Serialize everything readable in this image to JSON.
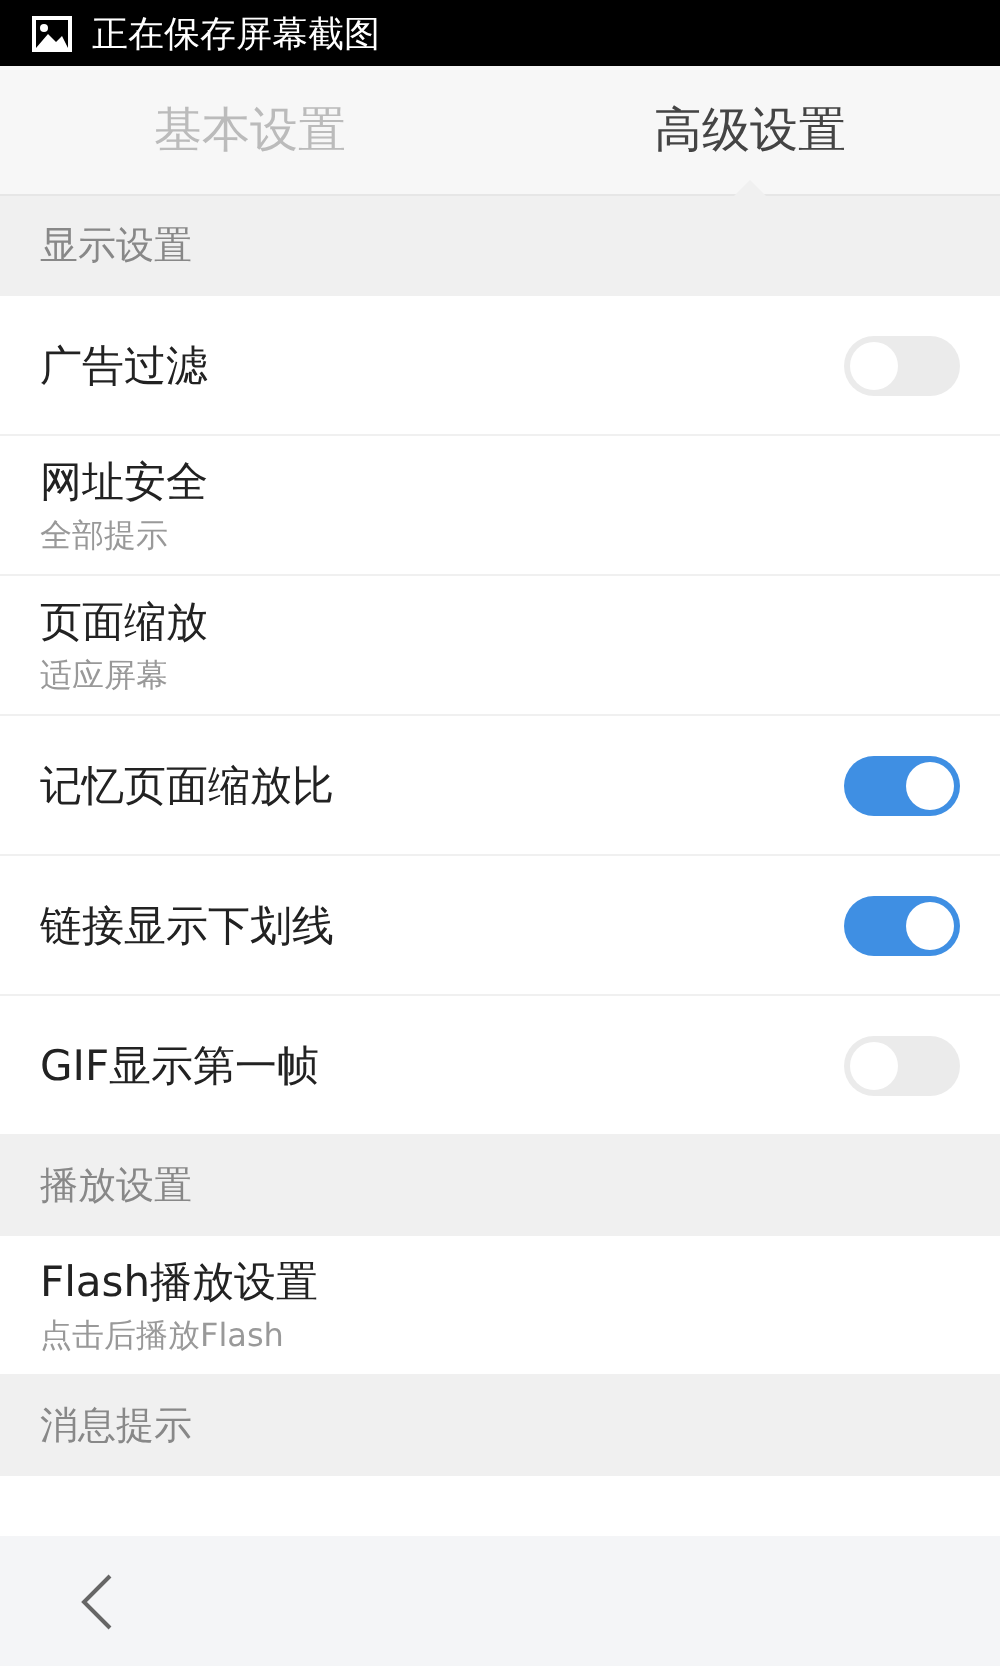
{
  "status_bar": {
    "notification": "正在保存屏幕截图"
  },
  "tabs": [
    {
      "label": "基本设置",
      "selected": false
    },
    {
      "label": "高级设置",
      "selected": true
    }
  ],
  "sections": [
    {
      "title": "显示设置",
      "items": [
        {
          "kind": "toggle",
          "label": "广告过滤",
          "on": false
        },
        {
          "kind": "value",
          "label": "网址安全",
          "value": "全部提示"
        },
        {
          "kind": "value",
          "label": "页面缩放",
          "value": "适应屏幕"
        },
        {
          "kind": "toggle",
          "label": "记忆页面缩放比",
          "on": true
        },
        {
          "kind": "toggle",
          "label": "链接显示下划线",
          "on": true
        },
        {
          "kind": "toggle",
          "label": "GIF显示第一帧",
          "on": false
        }
      ]
    },
    {
      "title": "播放设置",
      "items": [
        {
          "kind": "value",
          "label": "Flash播放设置",
          "value": "点击后播放Flash"
        }
      ]
    },
    {
      "title": "消息提示"
    }
  ]
}
